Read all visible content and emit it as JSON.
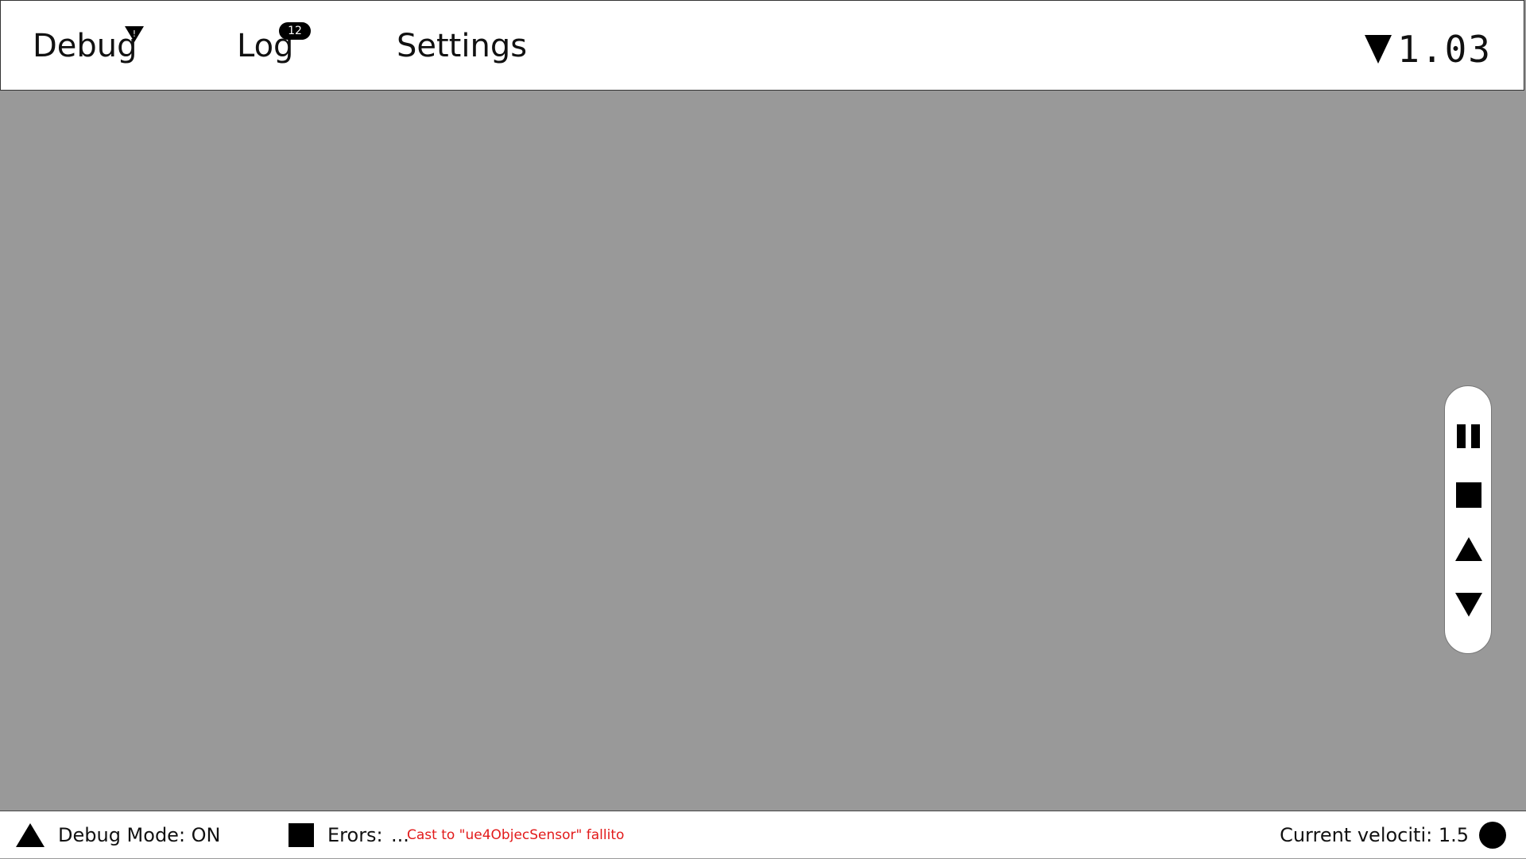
{
  "nav": {
    "debug_label": "Debug",
    "log_label": "Log",
    "log_count": "12",
    "settings_label": "Settings",
    "warning_mark": "!"
  },
  "version": {
    "text": "1.03",
    "logo_icon": "triangle-down-icon"
  },
  "controls": {
    "icons": [
      "pause-icon",
      "stop-icon",
      "triangle-up-icon",
      "triangle-down-icon"
    ]
  },
  "status": {
    "debug_mode": "Debug Mode: ON",
    "errors_label": "Erors:",
    "ellipsis": "...",
    "error_message": "Cast to \"ue4ObjecSensor\" fallito",
    "velocity": "Current velociti: 1.5"
  },
  "colors": {
    "header_bg": "#ffffff",
    "canvas_bg": "#999999",
    "error_text": "#e21a1a",
    "icon": "#000000"
  }
}
